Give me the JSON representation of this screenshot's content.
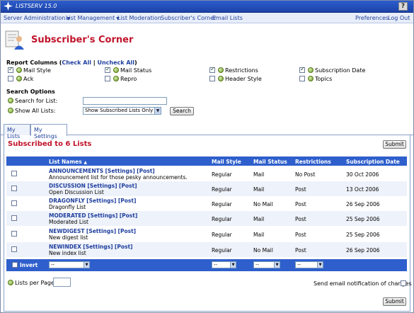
{
  "app": {
    "title": "LISTSERV 15.0",
    "help_label": "?"
  },
  "menu": {
    "server_admin": "Server Administration",
    "list_management": "List Management",
    "list_moderation": "List Moderation",
    "subscribers_corner": "Subscriber's Corner",
    "email_lists": "Email Lists",
    "preferences": "Preferences",
    "log_out": "Log Out"
  },
  "page_title": "Subscriber's Corner",
  "report_columns": {
    "label": "Report Columns",
    "check_all": "Check All",
    "separator": "|",
    "uncheck_all": "Uncheck All",
    "items": [
      {
        "label": "Mail Style",
        "checked": true
      },
      {
        "label": "Mail Status",
        "checked": true
      },
      {
        "label": "Restrictions",
        "checked": true
      },
      {
        "label": "Subscription Date",
        "checked": true
      },
      {
        "label": "Ack",
        "checked": false
      },
      {
        "label": "Repro",
        "checked": false
      },
      {
        "label": "Header Style",
        "checked": false
      },
      {
        "label": "Topics",
        "checked": false
      }
    ]
  },
  "search_options": {
    "label": "Search Options",
    "search_for_list": "Search for List:",
    "search_value": "",
    "show_all_lists": "Show All Lists:",
    "show_select_value": "Show Subscribed Lists Only",
    "search_button": "Search"
  },
  "tabs": {
    "my_lists": "My Lists",
    "my_settings": "My Settings",
    "active": "My Settings"
  },
  "subscribed_title": "Subscribed to 6 Lists",
  "submit_label": "Submit",
  "table": {
    "headers": {
      "list_names": "List Names",
      "sort_indicator": "▲",
      "mail_style": "Mail Style",
      "mail_status": "Mail Status",
      "restrictions": "Restrictions",
      "subscription_date": "Subscription Date"
    },
    "rows": [
      {
        "name": "ANNOUNCEMENTS",
        "settings": "[Settings]",
        "post": "[Post]",
        "desc": "Announcement list for those pesky announcements.",
        "mail_style": "Regular",
        "mail_status": "Mail",
        "restrictions": "No Post",
        "date": "30 Oct 2006"
      },
      {
        "name": "DISCUSSION",
        "settings": "[Settings]",
        "post": "[Post]",
        "desc": "Open Discussion List",
        "mail_style": "Regular",
        "mail_status": "Mail",
        "restrictions": "Post",
        "date": "13 Oct 2006"
      },
      {
        "name": "DRAGONFLY",
        "settings": "[Settings]",
        "post": "[Post]",
        "desc": "Dragonfly List",
        "mail_style": "Regular",
        "mail_status": "No Mail",
        "restrictions": "Post",
        "date": "26 Sep 2006"
      },
      {
        "name": "MODERATED",
        "settings": "[Settings]",
        "post": "[Post]",
        "desc": "Moderated List",
        "mail_style": "Regular",
        "mail_status": "Mail",
        "restrictions": "Post",
        "date": "25 Sep 2006"
      },
      {
        "name": "NEWDIGEST",
        "settings": "[Settings]",
        "post": "[Post]",
        "desc": "New digest list",
        "mail_style": "Regular",
        "mail_status": "Mail",
        "restrictions": "Post",
        "date": "25 Sep 2006"
      },
      {
        "name": "NEWINDEX",
        "settings": "[Settings]",
        "post": "[Post]",
        "desc": "New index list",
        "mail_style": "Regular",
        "mail_status": "No Mail",
        "restrictions": "Post",
        "date": "26 Sep 2006"
      }
    ],
    "footer": {
      "invert": "Invert",
      "select_placeholder": "--"
    }
  },
  "lists_per_page": {
    "label": "Lists per Page:",
    "value": ""
  },
  "send_email": "Send email notification of changes",
  "colors": {
    "title_red": "#c0142b",
    "header_blue": "#2e5fcc",
    "link_blue": "#1f3f9e"
  }
}
